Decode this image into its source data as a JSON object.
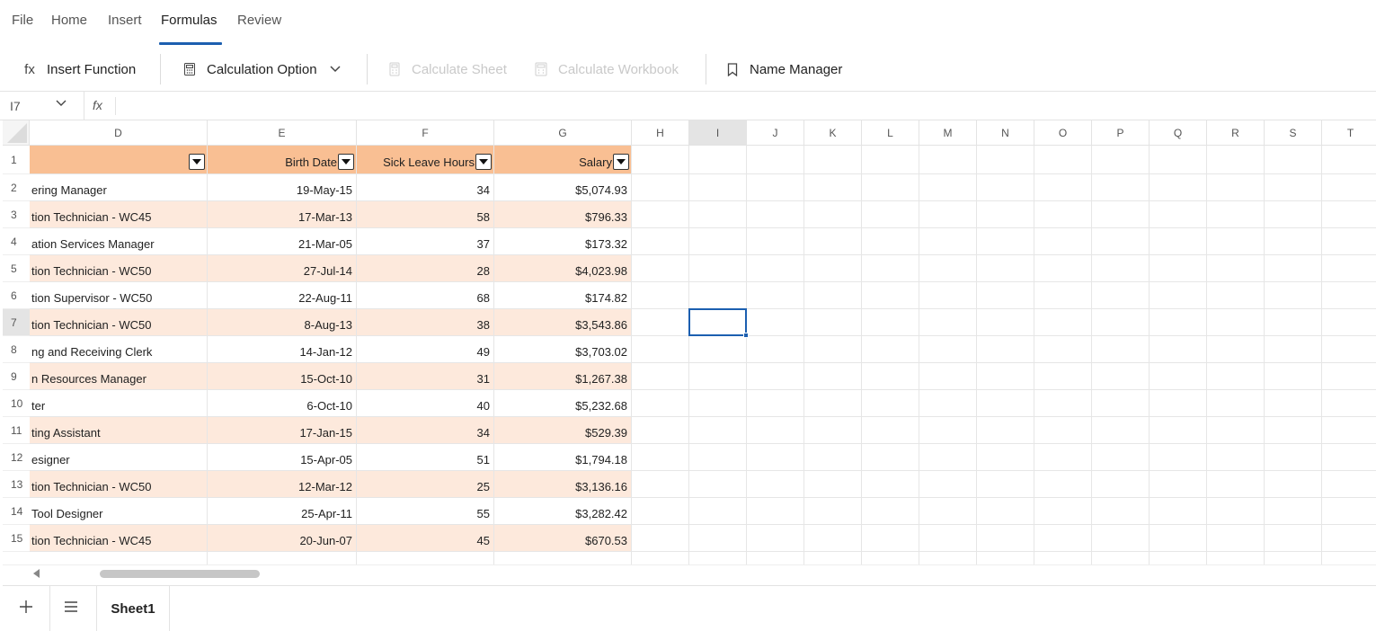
{
  "menu": {
    "tabs": [
      {
        "label": "File",
        "active": false
      },
      {
        "label": "Home",
        "active": false
      },
      {
        "label": "Insert",
        "active": false
      },
      {
        "label": "Formulas",
        "active": true
      },
      {
        "label": "Review",
        "active": false
      }
    ]
  },
  "ribbon": {
    "insert_function": {
      "icon": "fx",
      "label": "Insert Function"
    },
    "calculation_option": {
      "label": "Calculation Option"
    },
    "calculate_sheet": {
      "label": "Calculate Sheet",
      "disabled": true
    },
    "calculate_workbook": {
      "label": "Calculate Workbook",
      "disabled": true
    },
    "name_manager": {
      "label": "Name Manager"
    }
  },
  "formula_bar": {
    "name_box": "I7",
    "fx_label": "fx",
    "formula": ""
  },
  "grid": {
    "columns": [
      "D",
      "E",
      "F",
      "G",
      "H",
      "I",
      "J",
      "K",
      "L",
      "M",
      "N",
      "O",
      "P",
      "Q",
      "R",
      "S",
      "T"
    ],
    "selected_column": "I",
    "selected_row": "7",
    "header_row": {
      "row_number": "1",
      "D": "",
      "E": "Birth Date",
      "F": "Sick Leave Hours",
      "G": "Salary"
    },
    "rows": [
      {
        "row": "2",
        "D": "ering Manager",
        "E": "19-May-15",
        "F": "34",
        "G": "$5,074.93"
      },
      {
        "row": "3",
        "D": "tion Technician - WC45",
        "E": "17-Mar-13",
        "F": "58",
        "G": "$796.33"
      },
      {
        "row": "4",
        "D": "ation Services Manager",
        "E": "21-Mar-05",
        "F": "37",
        "G": "$173.32"
      },
      {
        "row": "5",
        "D": "tion Technician - WC50",
        "E": "27-Jul-14",
        "F": "28",
        "G": "$4,023.98"
      },
      {
        "row": "6",
        "D": "tion Supervisor - WC50",
        "E": "22-Aug-11",
        "F": "68",
        "G": "$174.82"
      },
      {
        "row": "7",
        "D": "tion Technician - WC50",
        "E": "8-Aug-13",
        "F": "38",
        "G": "$3,543.86"
      },
      {
        "row": "8",
        "D": "ng and Receiving Clerk",
        "E": "14-Jan-12",
        "F": "49",
        "G": "$3,703.02"
      },
      {
        "row": "9",
        "D": "n Resources Manager",
        "E": "15-Oct-10",
        "F": "31",
        "G": "$1,267.38"
      },
      {
        "row": "10",
        "D": "ter",
        "E": "6-Oct-10",
        "F": "40",
        "G": "$5,232.68"
      },
      {
        "row": "11",
        "D": "ting Assistant",
        "E": "17-Jan-15",
        "F": "34",
        "G": "$529.39"
      },
      {
        "row": "12",
        "D": "esigner",
        "E": "15-Apr-05",
        "F": "51",
        "G": "$1,794.18"
      },
      {
        "row": "13",
        "D": "tion Technician - WC50",
        "E": "12-Mar-12",
        "F": "25",
        "G": "$3,136.16"
      },
      {
        "row": "14",
        "D": "Tool Designer",
        "E": "25-Apr-11",
        "F": "55",
        "G": "$3,282.42"
      },
      {
        "row": "15",
        "D": "tion Technician - WC45",
        "E": "20-Jun-07",
        "F": "45",
        "G": "$670.53"
      }
    ]
  },
  "colors": {
    "header_fill": "#f9bf93",
    "band_fill": "#fde9dc",
    "accent": "#1c5fb0"
  },
  "sheets": {
    "tabs": [
      {
        "label": "Sheet1",
        "active": true
      }
    ]
  }
}
